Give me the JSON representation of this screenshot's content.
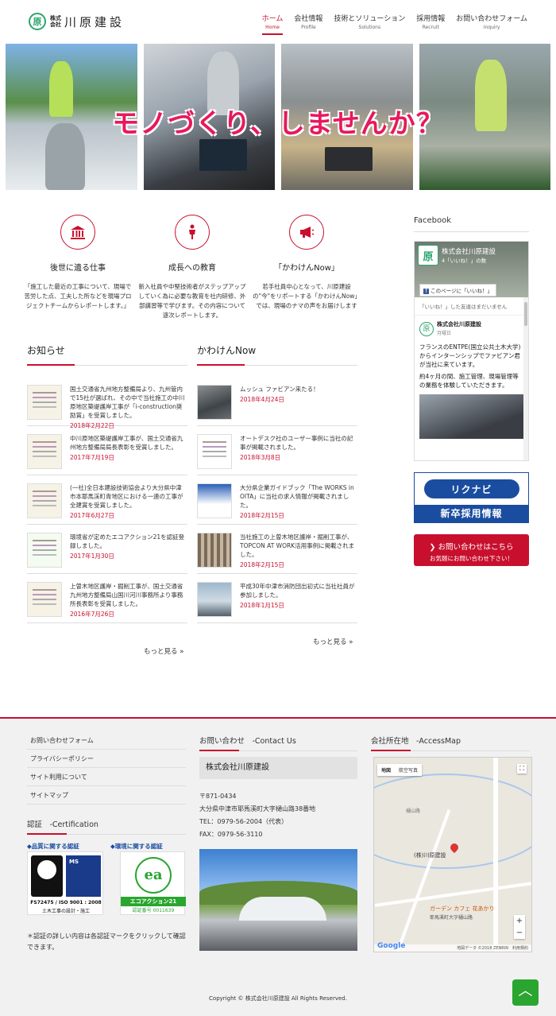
{
  "header": {
    "logo_mark": "原",
    "logo_kabu_1": "株式",
    "logo_kabu_2": "会社",
    "logo_name": "川原建設",
    "nav": [
      {
        "jp": "ホーム",
        "en": "Home"
      },
      {
        "jp": "会社情報",
        "en": "Profile"
      },
      {
        "jp": "技術とソリューション",
        "en": "Solutions"
      },
      {
        "jp": "採用情報",
        "en": "Recruit"
      },
      {
        "jp": "お問い合わせフォーム",
        "en": "Inquiry"
      }
    ]
  },
  "hero": {
    "headline": "モノづくり、しませんか？"
  },
  "features": [
    {
      "title": "後世に遺る仕事",
      "desc": "「施工した最近の工事について、現場で苦労した点、工夫した所などを現場プロジェクトチームからレポートします。」"
    },
    {
      "title": "成長への教育",
      "desc": "新入社員や中堅技術者がステップアップしていく為に必要な教育を社内研修、外部講習等で学びます。その内容について逐次レポートします。"
    },
    {
      "title": "「かわけんNow」",
      "desc": "若手社員中心となって、川原建設の\"今\"をリポートする「かわけんNow」では、現場のナマの声をお届けします"
    }
  ],
  "news": {
    "title": "お知らせ",
    "items": [
      {
        "text": "国土交通省九州地方整備局より、九州管内で15社が選ばれ、その中で当社施工の中川原地区築堤護岸工事が「i-construction奨励賞」を受賞しました。",
        "date": "2018年2月22日"
      },
      {
        "text": "中川原地区築堤護岸工事が、国土交通省九州地方整備局局長表彰を受賞しました。",
        "date": "2017年7月19日"
      },
      {
        "text": "(一社)全日本建設技術協会より大分県中津市本耶馬渓町青地区における一連の工事が全建賞を受賞しました。",
        "date": "2017年6月27日"
      },
      {
        "text": "環境省が定めたエコアクション21を認証登録しました。",
        "date": "2017年1月30日"
      },
      {
        "text": "上曽木地区護岸・掘削工事が、国土交通省九州地方整備局山国川河川事務所より事務所長表彰を受賞しました。",
        "date": "2016年7月26日"
      }
    ],
    "more": "もっと見る »"
  },
  "kawaken": {
    "title": "かわけんNow",
    "items": [
      {
        "text": "ムッシュ ファビアン来たる！",
        "date": "2018年4月24日"
      },
      {
        "text": "オートデスク社のユーザー事例に当社の記事が掲載されました。",
        "date": "2018年3月8日"
      },
      {
        "text": "大分県企業ガイドブック「The WORKS in OITA」に当社の求人情報が掲載されました。",
        "date": "2018年2月15日"
      },
      {
        "text": "当社施工の上曽木地区護岸・掘削工事が、TOPCON AT WORK活用事例に掲載されました。",
        "date": "2018年2月15日"
      },
      {
        "text": "平成30年中津市消防団出初式に当社社員が参加しました。",
        "date": "2018年1月15日"
      }
    ],
    "more": "もっと見る »"
  },
  "sidebar": {
    "facebook_title": "Facebook",
    "fb_page_name": "株式会社川原建設",
    "fb_likes": "4「いいね！」の数",
    "fb_like_button": "このページに「いいね！」",
    "fb_friends": "「いいね！」した友達はまだいません",
    "fb_post_name": "株式会社川原建設",
    "fb_post_time": "月曜日",
    "fb_post_text1": "フランスのENTPE(国立公共土木大学)からインターンシップでファビアン君が当社に来ています。",
    "fb_post_text2": "約4ヶ月の間、施工管理、現場管理等の業務を体験していただきます。",
    "rikunabi_logo": "リクナビ",
    "rikunabi_text": "新卒採用情報",
    "contact_line1": "お問い合わせはこちら",
    "contact_line2": "お気軽にお問い合わせ下さい！"
  },
  "footer": {
    "links": [
      "お問い合わせフォーム",
      "プライバシーポリシー",
      "サイト利用について",
      "サイトマップ"
    ],
    "cert_title": "認証　-Certification",
    "cert_quality_label": "◆品質に関する認証",
    "cert_env_label": "◆環境に関する認証",
    "cert_iso_text": "FS72475 / ISO 9001 : 2008",
    "cert_iso_sub": "土木工事の設計・施工",
    "cert_ea_text": "エコアクション21",
    "cert_ea_num": "認証番号 0011639",
    "cert_note": "＊認証の詳しい内容は各認証マークをクリックして確認できます。",
    "contact_title": "お問い合わせ　-Contact Us",
    "company": "株式会社川原建設",
    "postal": "〒871-0434",
    "address": "大分県中津市耶馬溪町大字樋山路38番地",
    "tel": "TEL：0979-56-2004（代表）",
    "fax": "FAX：0979-56-3110",
    "access_title": "会社所在地　-AccessMap",
    "map_tab_map": "地図",
    "map_tab_sat": "航空写真",
    "map_label_company": "(株)川原建設",
    "map_label_cafe": "ガーデン カフェ 花あかり",
    "map_label_school": "耶馬溪町大字樋山路",
    "map_label_hiyama": "樋山路",
    "map_google": "Google",
    "map_credit": "地図データ ©2018 ZENRIN　利用規約",
    "copyright": "Copyright © 株式会社川原建設 All Rights Reserved."
  }
}
